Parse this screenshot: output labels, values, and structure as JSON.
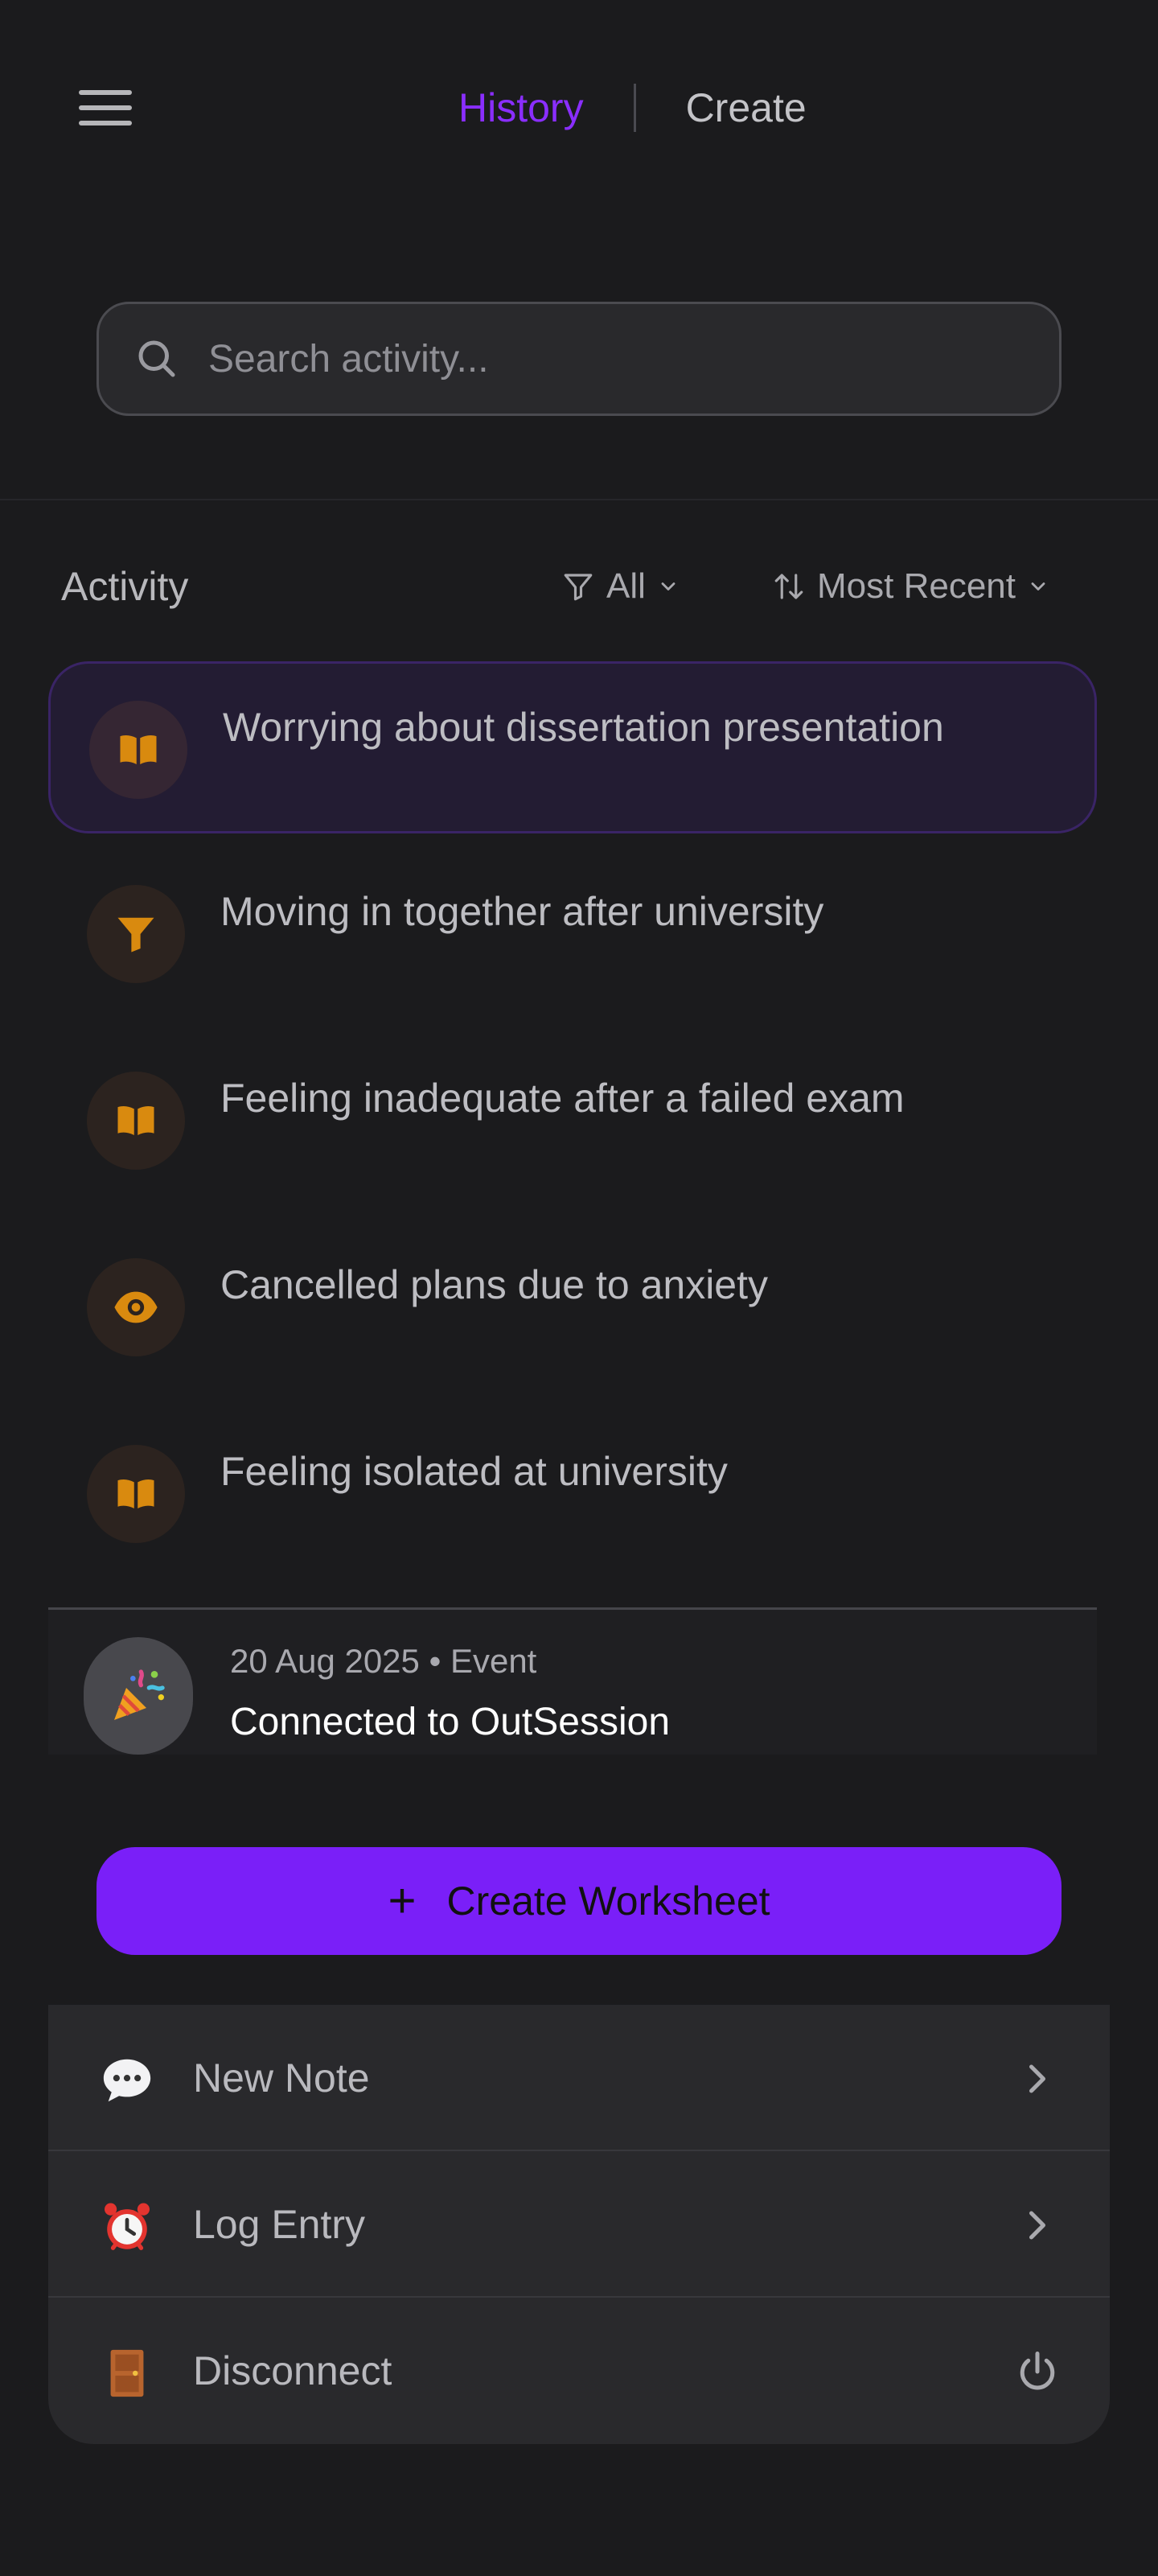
{
  "header": {
    "tabs": [
      {
        "label": "History",
        "active": true
      },
      {
        "label": "Create",
        "active": false
      }
    ]
  },
  "search": {
    "placeholder": "Search activity...",
    "value": ""
  },
  "activity": {
    "title": "Activity",
    "filter_label": "All",
    "sort_label": "Most Recent",
    "items": [
      {
        "title": "Worrying about dissertation presentation",
        "icon": "book-icon",
        "selected": true
      },
      {
        "title": "Moving in together after university",
        "icon": "funnel-icon",
        "selected": false
      },
      {
        "title": "Feeling inadequate after a failed exam",
        "icon": "book-icon",
        "selected": false
      },
      {
        "title": "Cancelled plans due to anxiety",
        "icon": "eye-icon",
        "selected": false
      },
      {
        "title": "Feeling isolated at university",
        "icon": "book-icon",
        "selected": false
      }
    ]
  },
  "event": {
    "meta": "20 Aug 2025 • Event",
    "title": "Connected to OutSession",
    "icon": "party-popper-icon"
  },
  "create_button": {
    "label": "Create Worksheet"
  },
  "menu": {
    "items": [
      {
        "label": "New Note",
        "icon": "speech-bubble-icon",
        "trail": "chevron-right-icon"
      },
      {
        "label": "Log Entry",
        "icon": "alarm-clock-icon",
        "trail": "chevron-right-icon"
      },
      {
        "label": "Disconnect",
        "icon": "door-icon",
        "trail": "power-icon"
      }
    ]
  },
  "colors": {
    "background": "#1b1b1d",
    "accent": "#8a2eff",
    "button": "#7a1ff8",
    "icon_amber": "#d98a0f"
  }
}
